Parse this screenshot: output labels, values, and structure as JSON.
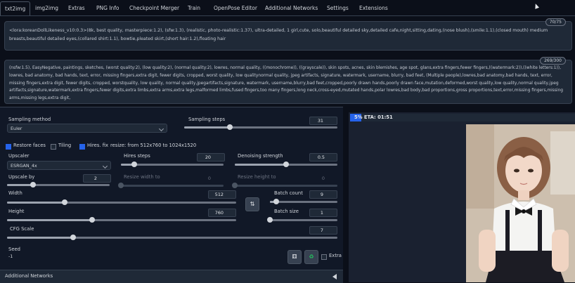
{
  "tabs": [
    "txt2img",
    "img2img",
    "Extras",
    "PNG Info",
    "Checkpoint Merger",
    "Train",
    "OpenPose Editor",
    "Additional Networks",
    "Settings",
    "Extensions"
  ],
  "prompt": {
    "text": "<lora:koreanDollLikeness_v10:0.3>(8k, best quality, masterpiece:1.2), (sfw:1.3), (realistic, photo-realistic:1.37), ultra-detailed, 1 girl,cute, solo,beautiful detailed sky,detailed cafe,night,sitting,dating,(nose blush),(smile:1.1),(closed mouth) medium breasts,beautiful detailed eyes,(collared shirt:1.1), bowtie,pleated skirt,(short hair:1.2),floating hair",
    "counter": "70/75"
  },
  "negative": {
    "text": "(nsfw:1.5), EasyNegative, paintings, sketches, (worst quality:2), (low quality:2), (normal quality:2), lowres, normal quality, ((monochrome)), ((grayscale)), skin spots, acnes, skin blemishes, age spot, glans,extra fingers,fewer fingers,((watermark:2)),((white letters:1)), lowres, bad anatomy, bad hands, text, error, missing fingers,extra digit, fewer digits, cropped, worst quality, low qualitynormal quality, jpeg artifacts, signature, watermark, username, blurry, bad feet, (Multiple people),lowres,bad anatomy,bad hands, text, error, missing fingers,extra digit, fewer digits, cropped, worstquality, low quality, normal quality,jpegartifacts,signature, watermark, username,blurry,bad feet,cropped,poorly drawn hands,poorly drawn face,mutation,deformed,worst quality,low quality,normal quality,jpeg artifacts,signature,watermark,extra fingers,fewer digits,extra limbs,extra arms,extra legs,malformed limbs,fused fingers,too many fingers,long neck,cross-eyed,mutated hands,polar lowres,bad body,bad proportions,gross proportions,text,error,missing fingers,missing arms,missing legs,extra digit,",
    "counter": "269/300"
  },
  "sampling": {
    "method_label": "Sampling method",
    "method_value": "Euler",
    "steps_label": "Sampling steps",
    "steps_value": "31",
    "steps_fraction": 0.3
  },
  "checks": {
    "restore_faces": "Restore faces",
    "tiling": "Tiling",
    "hires_fix": "Hires. fix",
    "resize_note": "resize: from 512x760 to 1024x1520"
  },
  "hires": {
    "upscaler_label": "Upscaler",
    "upscaler_value": "ESRGAN_4x",
    "steps_label": "Hires steps",
    "steps_value": "20",
    "steps_fraction": 0.13,
    "denoise_label": "Denoising strength",
    "denoise_value": "0.5",
    "denoise_fraction": 0.5,
    "upscale_by_label": "Upscale by",
    "upscale_by_value": "2",
    "upscale_by_fraction": 0.25,
    "resize_w_label": "Resize width to",
    "resize_w_value": "0",
    "resize_h_label": "Resize height to",
    "resize_h_value": "0"
  },
  "dims": {
    "width_label": "Width",
    "width_value": "512",
    "width_fraction": 0.25,
    "height_label": "Height",
    "height_value": "760",
    "height_fraction": 0.37,
    "batch_count_label": "Batch count",
    "batch_count_value": "9",
    "batch_count_fraction": 0.09,
    "batch_size_label": "Batch size",
    "batch_size_value": "1",
    "batch_size_fraction": 0.0,
    "swap_icon": "⇅"
  },
  "cfg": {
    "label": "CFG Scale",
    "value": "7",
    "fraction": 0.2
  },
  "seed": {
    "label": "Seed",
    "value": "-1",
    "dice_icon": "⚅",
    "recycle_icon": "♻",
    "extra_label": "Extra"
  },
  "additional_networks": "Additional Networks",
  "progress": {
    "text": "5% ETA: 01:51",
    "fraction": 0.05
  },
  "colors": {
    "accent": "#2563eb",
    "background": "#0b0f19",
    "panel": "#111827"
  }
}
